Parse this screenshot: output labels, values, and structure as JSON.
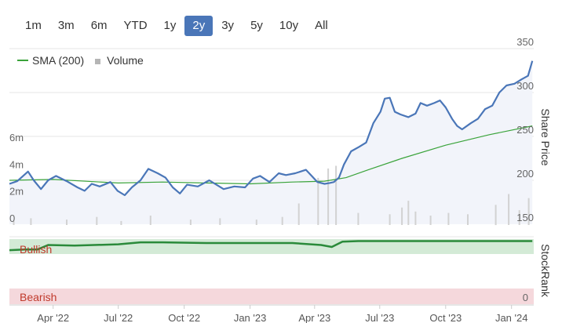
{
  "range_selector": {
    "buttons": [
      "1m",
      "3m",
      "6m",
      "YTD",
      "1y",
      "2y",
      "3y",
      "5y",
      "10y",
      "All"
    ],
    "active": "2y"
  },
  "legend": {
    "sma_label": "SMA (200)",
    "volume_label": "Volume"
  },
  "colors": {
    "price_line": "#4a76b8",
    "price_fill": "#f2f4fa",
    "sma_line": "#3aa33a",
    "volume_bar": "#d2d2d2",
    "active_button": "#4a76b8",
    "bullish_band": "#d3ead6",
    "bearish_band": "#f5d8dc",
    "stockrank_line": "#2a8a3a",
    "grid": "#e6e6e6"
  },
  "chart_data": [
    {
      "type": "line",
      "title": "",
      "ylabel": "Share Price",
      "right_axis_ticks": [
        150,
        200,
        250,
        300,
        350
      ],
      "ylim": [
        150,
        350
      ],
      "volume_axis_ticks": [
        "0",
        "2m",
        "4m",
        "6m"
      ],
      "volume_ylim": [
        0,
        6000000
      ],
      "x_ticks": [
        "Apr '22",
        "Jul '22",
        "Oct '22",
        "Jan '23",
        "Apr '23",
        "Jul '23",
        "Oct '23",
        "Jan '24"
      ],
      "x_start": "2022-01-30",
      "x_end": "2024-02-01",
      "series": [
        {
          "name": "",
          "role": "price",
          "points": [
            [
              "2022-01-30",
              196
            ],
            [
              "2022-02-10",
              199
            ],
            [
              "2022-02-25",
              210
            ],
            [
              "2022-03-05",
              200
            ],
            [
              "2022-03-15",
              190
            ],
            [
              "2022-03-25",
              200
            ],
            [
              "2022-04-05",
              205
            ],
            [
              "2022-04-20",
              199
            ],
            [
              "2022-05-05",
              192
            ],
            [
              "2022-05-15",
              188
            ],
            [
              "2022-05-25",
              196
            ],
            [
              "2022-06-05",
              193
            ],
            [
              "2022-06-20",
              198
            ],
            [
              "2022-06-30",
              188
            ],
            [
              "2022-07-10",
              183
            ],
            [
              "2022-07-20",
              192
            ],
            [
              "2022-08-01",
              200
            ],
            [
              "2022-08-12",
              213
            ],
            [
              "2022-08-25",
              208
            ],
            [
              "2022-09-05",
              203
            ],
            [
              "2022-09-15",
              192
            ],
            [
              "2022-09-25",
              185
            ],
            [
              "2022-10-05",
              195
            ],
            [
              "2022-10-20",
              193
            ],
            [
              "2022-11-05",
              200
            ],
            [
              "2022-11-15",
              195
            ],
            [
              "2022-11-25",
              190
            ],
            [
              "2022-12-10",
              193
            ],
            [
              "2022-12-25",
              192
            ],
            [
              "2023-01-05",
              202
            ],
            [
              "2023-01-15",
              205
            ],
            [
              "2023-01-28",
              198
            ],
            [
              "2023-02-10",
              208
            ],
            [
              "2023-02-20",
              206
            ],
            [
              "2023-03-05",
              208
            ],
            [
              "2023-03-20",
              212
            ],
            [
              "2023-03-28",
              205
            ],
            [
              "2023-04-05",
              198
            ],
            [
              "2023-04-15",
              196
            ],
            [
              "2023-04-22",
              197
            ],
            [
              "2023-04-28",
              198
            ],
            [
              "2023-05-05",
              203
            ],
            [
              "2023-05-12",
              218
            ],
            [
              "2023-05-22",
              233
            ],
            [
              "2023-06-02",
              238
            ],
            [
              "2023-06-12",
              243
            ],
            [
              "2023-06-22",
              265
            ],
            [
              "2023-07-02",
              278
            ],
            [
              "2023-07-08",
              293
            ],
            [
              "2023-07-15",
              294
            ],
            [
              "2023-07-22",
              278
            ],
            [
              "2023-07-30",
              275
            ],
            [
              "2023-08-10",
              272
            ],
            [
              "2023-08-20",
              276
            ],
            [
              "2023-08-27",
              288
            ],
            [
              "2023-09-05",
              285
            ],
            [
              "2023-09-15",
              288
            ],
            [
              "2023-09-23",
              291
            ],
            [
              "2023-10-01",
              283
            ],
            [
              "2023-10-10",
              270
            ],
            [
              "2023-10-17",
              262
            ],
            [
              "2023-10-24",
              258
            ],
            [
              "2023-11-05",
              265
            ],
            [
              "2023-11-15",
              270
            ],
            [
              "2023-11-25",
              281
            ],
            [
              "2023-12-05",
              285
            ],
            [
              "2023-12-15",
              300
            ],
            [
              "2023-12-25",
              308
            ],
            [
              "2024-01-05",
              310
            ],
            [
              "2024-01-15",
              315
            ],
            [
              "2024-01-24",
              319
            ],
            [
              "2024-01-30",
              336
            ]
          ]
        },
        {
          "name": "SMA (200)",
          "role": "sma",
          "points": [
            [
              "2022-01-30",
              200
            ],
            [
              "2022-04-01",
              201
            ],
            [
              "2022-07-01",
              197
            ],
            [
              "2022-09-01",
              198
            ],
            [
              "2022-11-01",
              197
            ],
            [
              "2023-01-01",
              196
            ],
            [
              "2023-03-01",
              198
            ],
            [
              "2023-04-15",
              199
            ],
            [
              "2023-05-15",
              203
            ],
            [
              "2023-06-15",
              212
            ],
            [
              "2023-08-01",
              225
            ],
            [
              "2023-10-01",
              240
            ],
            [
              "2023-12-01",
              252
            ],
            [
              "2024-01-30",
              262
            ]
          ]
        },
        {
          "name": "Volume",
          "role": "volume",
          "points": [
            [
              "2022-02-05",
              300000
            ],
            [
              "2022-03-01",
              500000
            ],
            [
              "2022-04-20",
              400000
            ],
            [
              "2022-06-01",
              600000
            ],
            [
              "2022-07-05",
              300000
            ],
            [
              "2022-08-15",
              700000
            ],
            [
              "2022-10-10",
              400000
            ],
            [
              "2022-11-20",
              500000
            ],
            [
              "2023-01-10",
              400000
            ],
            [
              "2023-02-15",
              600000
            ],
            [
              "2023-03-10",
              1600000
            ],
            [
              "2023-04-06",
              3500000
            ],
            [
              "2023-04-20",
              4200000
            ],
            [
              "2023-05-01",
              4400000
            ],
            [
              "2023-06-01",
              900000
            ],
            [
              "2023-07-15",
              800000
            ],
            [
              "2023-08-01",
              1300000
            ],
            [
              "2023-08-10",
              1800000
            ],
            [
              "2023-08-20",
              1000000
            ],
            [
              "2023-09-10",
              700000
            ],
            [
              "2023-10-05",
              900000
            ],
            [
              "2023-11-01",
              800000
            ],
            [
              "2023-12-10",
              1500000
            ],
            [
              "2023-12-28",
              2300000
            ],
            [
              "2024-01-12",
              1100000
            ],
            [
              "2024-01-25",
              2000000
            ]
          ]
        }
      ]
    },
    {
      "type": "line",
      "title": "",
      "ylabel": "StockRank",
      "band_labels": [
        "Bullish",
        "Bearish"
      ],
      "right_axis_ticks": [
        0
      ],
      "series": [
        {
          "name": "",
          "points": [
            [
              "2022-01-30",
              83
            ],
            [
              "2022-02-20",
              84
            ],
            [
              "2022-03-10",
              84
            ],
            [
              "2022-03-25",
              91
            ],
            [
              "2022-05-01",
              90
            ],
            [
              "2022-07-01",
              92
            ],
            [
              "2022-08-01",
              95
            ],
            [
              "2022-09-01",
              95
            ],
            [
              "2022-11-01",
              94
            ],
            [
              "2023-01-01",
              94
            ],
            [
              "2023-03-01",
              94
            ],
            [
              "2023-04-10",
              91
            ],
            [
              "2023-04-25",
              88
            ],
            [
              "2023-05-10",
              96
            ],
            [
              "2023-06-01",
              97
            ],
            [
              "2024-01-30",
              97
            ]
          ]
        }
      ]
    }
  ]
}
